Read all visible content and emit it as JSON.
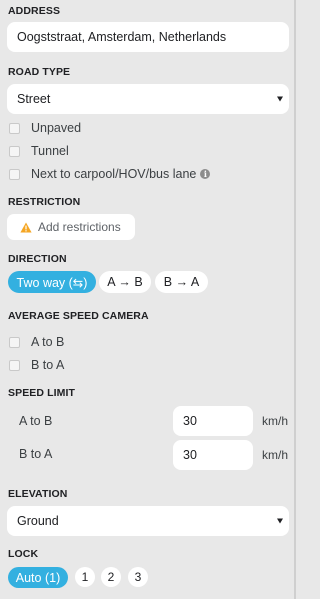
{
  "address": {
    "title": "ADDRESS",
    "value": "Oogststraat, Amsterdam, Netherlands"
  },
  "road_type": {
    "title": "ROAD TYPE",
    "selected": "Street",
    "options": [
      {
        "label": "Unpaved",
        "checked": false
      },
      {
        "label": "Tunnel",
        "checked": false
      },
      {
        "label": "Next to carpool/HOV/bus lane",
        "checked": false
      }
    ],
    "info_icon": "info-icon"
  },
  "restriction": {
    "title": "RESTRICTION",
    "button_label": "Add restrictions",
    "icon": "warning-icon"
  },
  "direction": {
    "title": "DIRECTION",
    "options": [
      {
        "label": "Two way (⇆)",
        "active": true
      },
      {
        "label": "A → B",
        "active": false
      },
      {
        "label": "B → A",
        "active": false
      }
    ]
  },
  "speed_camera": {
    "title": "AVERAGE SPEED CAMERA",
    "options": [
      {
        "label": "A to B",
        "checked": false
      },
      {
        "label": "B to A",
        "checked": false
      }
    ]
  },
  "speed_limit": {
    "title": "SPEED LIMIT",
    "rows": [
      {
        "label": "A to B",
        "value": "30",
        "unit": "km/h"
      },
      {
        "label": "B to A",
        "value": "30",
        "unit": "km/h"
      }
    ]
  },
  "elevation": {
    "title": "ELEVATION",
    "selected": "Ground"
  },
  "lock": {
    "title": "LOCK",
    "auto_label": "Auto (1)",
    "levels": [
      "1",
      "2",
      "3"
    ]
  },
  "colors": {
    "accent": "#33b0e0",
    "background": "#e8e8e8",
    "warning": "#f5a623"
  }
}
